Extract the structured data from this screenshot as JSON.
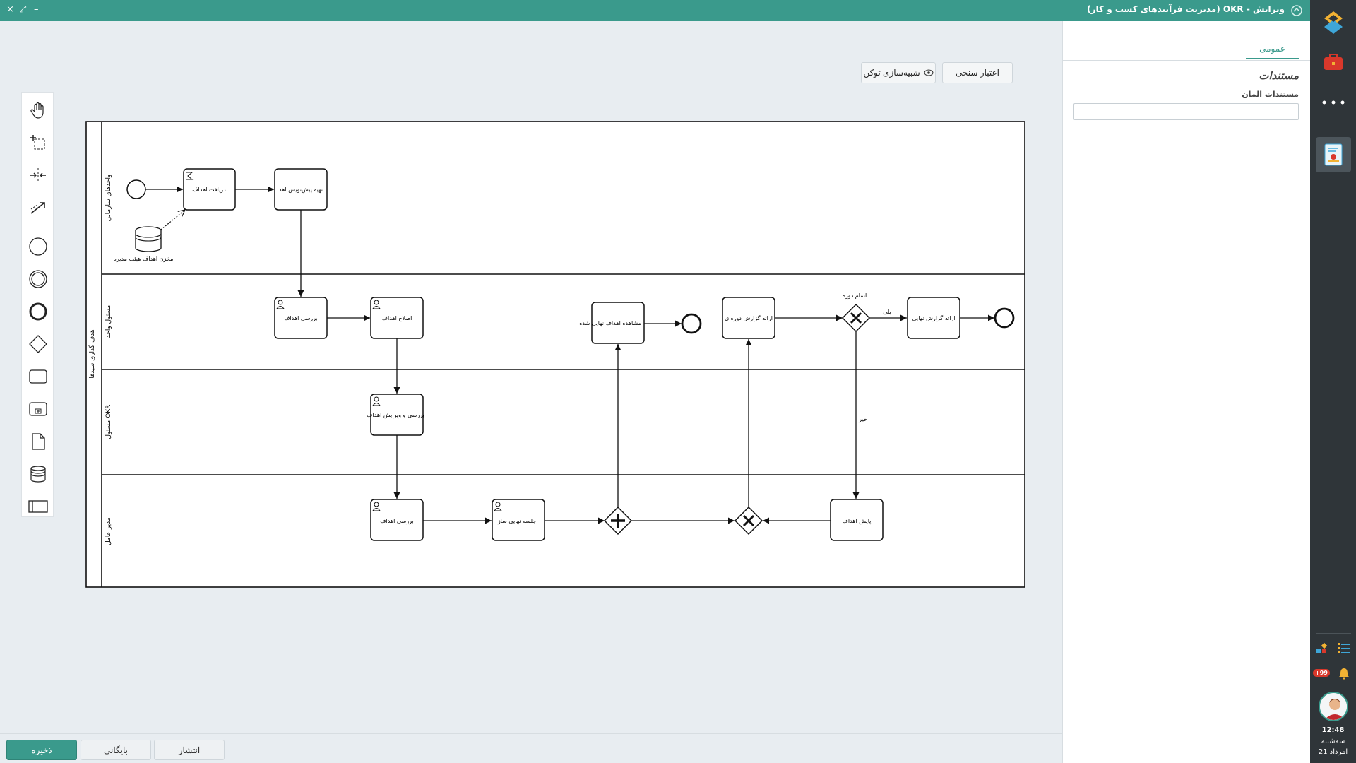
{
  "title_bar": {
    "title": "ویرایش - OKR  (مدیریت فرآیندهای کسب و کار)",
    "close_glyph": "×",
    "maximize_glyph": "⤢",
    "minimize_glyph": "–"
  },
  "toolbar": {
    "validate_label": "اعتبار سنجی",
    "simulate_label": "شبیه‌سازی توکن"
  },
  "palette": {
    "tools": [
      "hand-tool-icon",
      "lasso-tool-icon",
      "space-tool-icon",
      "connect-tool-icon",
      "start-event-icon",
      "intermediate-event-icon",
      "end-event-icon",
      "gateway-icon",
      "task-icon",
      "subprocess-icon",
      "data-object-icon",
      "data-store-icon",
      "pool-icon"
    ]
  },
  "diagram": {
    "pool_label": "هدف گذاری سیدفا",
    "lanes": [
      "واحدهای سازمانی",
      "مسئول واحد",
      "مسئول OKR",
      "مدیر عامل"
    ],
    "tasks": {
      "receive_goals": "دریافت اهداف",
      "draft_goals": "تهیه پیش‌نویس اهد",
      "review_goals_1": "بررسی اهداف",
      "fix_goals": "اصلاح اهداف",
      "view_final_goals": "مشاهده اهداف نهایی شده",
      "periodic_report": "ارائه گزارش دوره‌ای",
      "final_report": "ارائه گزارش نهایی",
      "review_edit_goals": "بررسی و ویرایش اهداف",
      "review_goals_2": "بررسی اهداف",
      "final_meeting": "جلسه نهایی ساز",
      "monitor_goals": "پایش اهداف"
    },
    "data_store": "مخزن اهداف هیئت مدیره",
    "gateway_label": "اتمام دوره",
    "flow_yes": "بلی",
    "flow_no": "خیر"
  },
  "properties": {
    "tab_general": "عمومی",
    "section_title": "مستندات",
    "field_label": "مستندات المان",
    "field_value": ""
  },
  "bottom_bar": {
    "publish_label": "انتشار",
    "archive_label": "بایگانی",
    "save_label": "ذخیره"
  },
  "sidebar": {
    "notification_badge": "+99",
    "time": "12:48",
    "weekday": "سه‌شنبه",
    "date": "21 امرداد"
  },
  "colors": {
    "accent": "#3a9a8c",
    "sidebar_bg": "#2f3539",
    "canvas_bg": "#e8edf1"
  }
}
